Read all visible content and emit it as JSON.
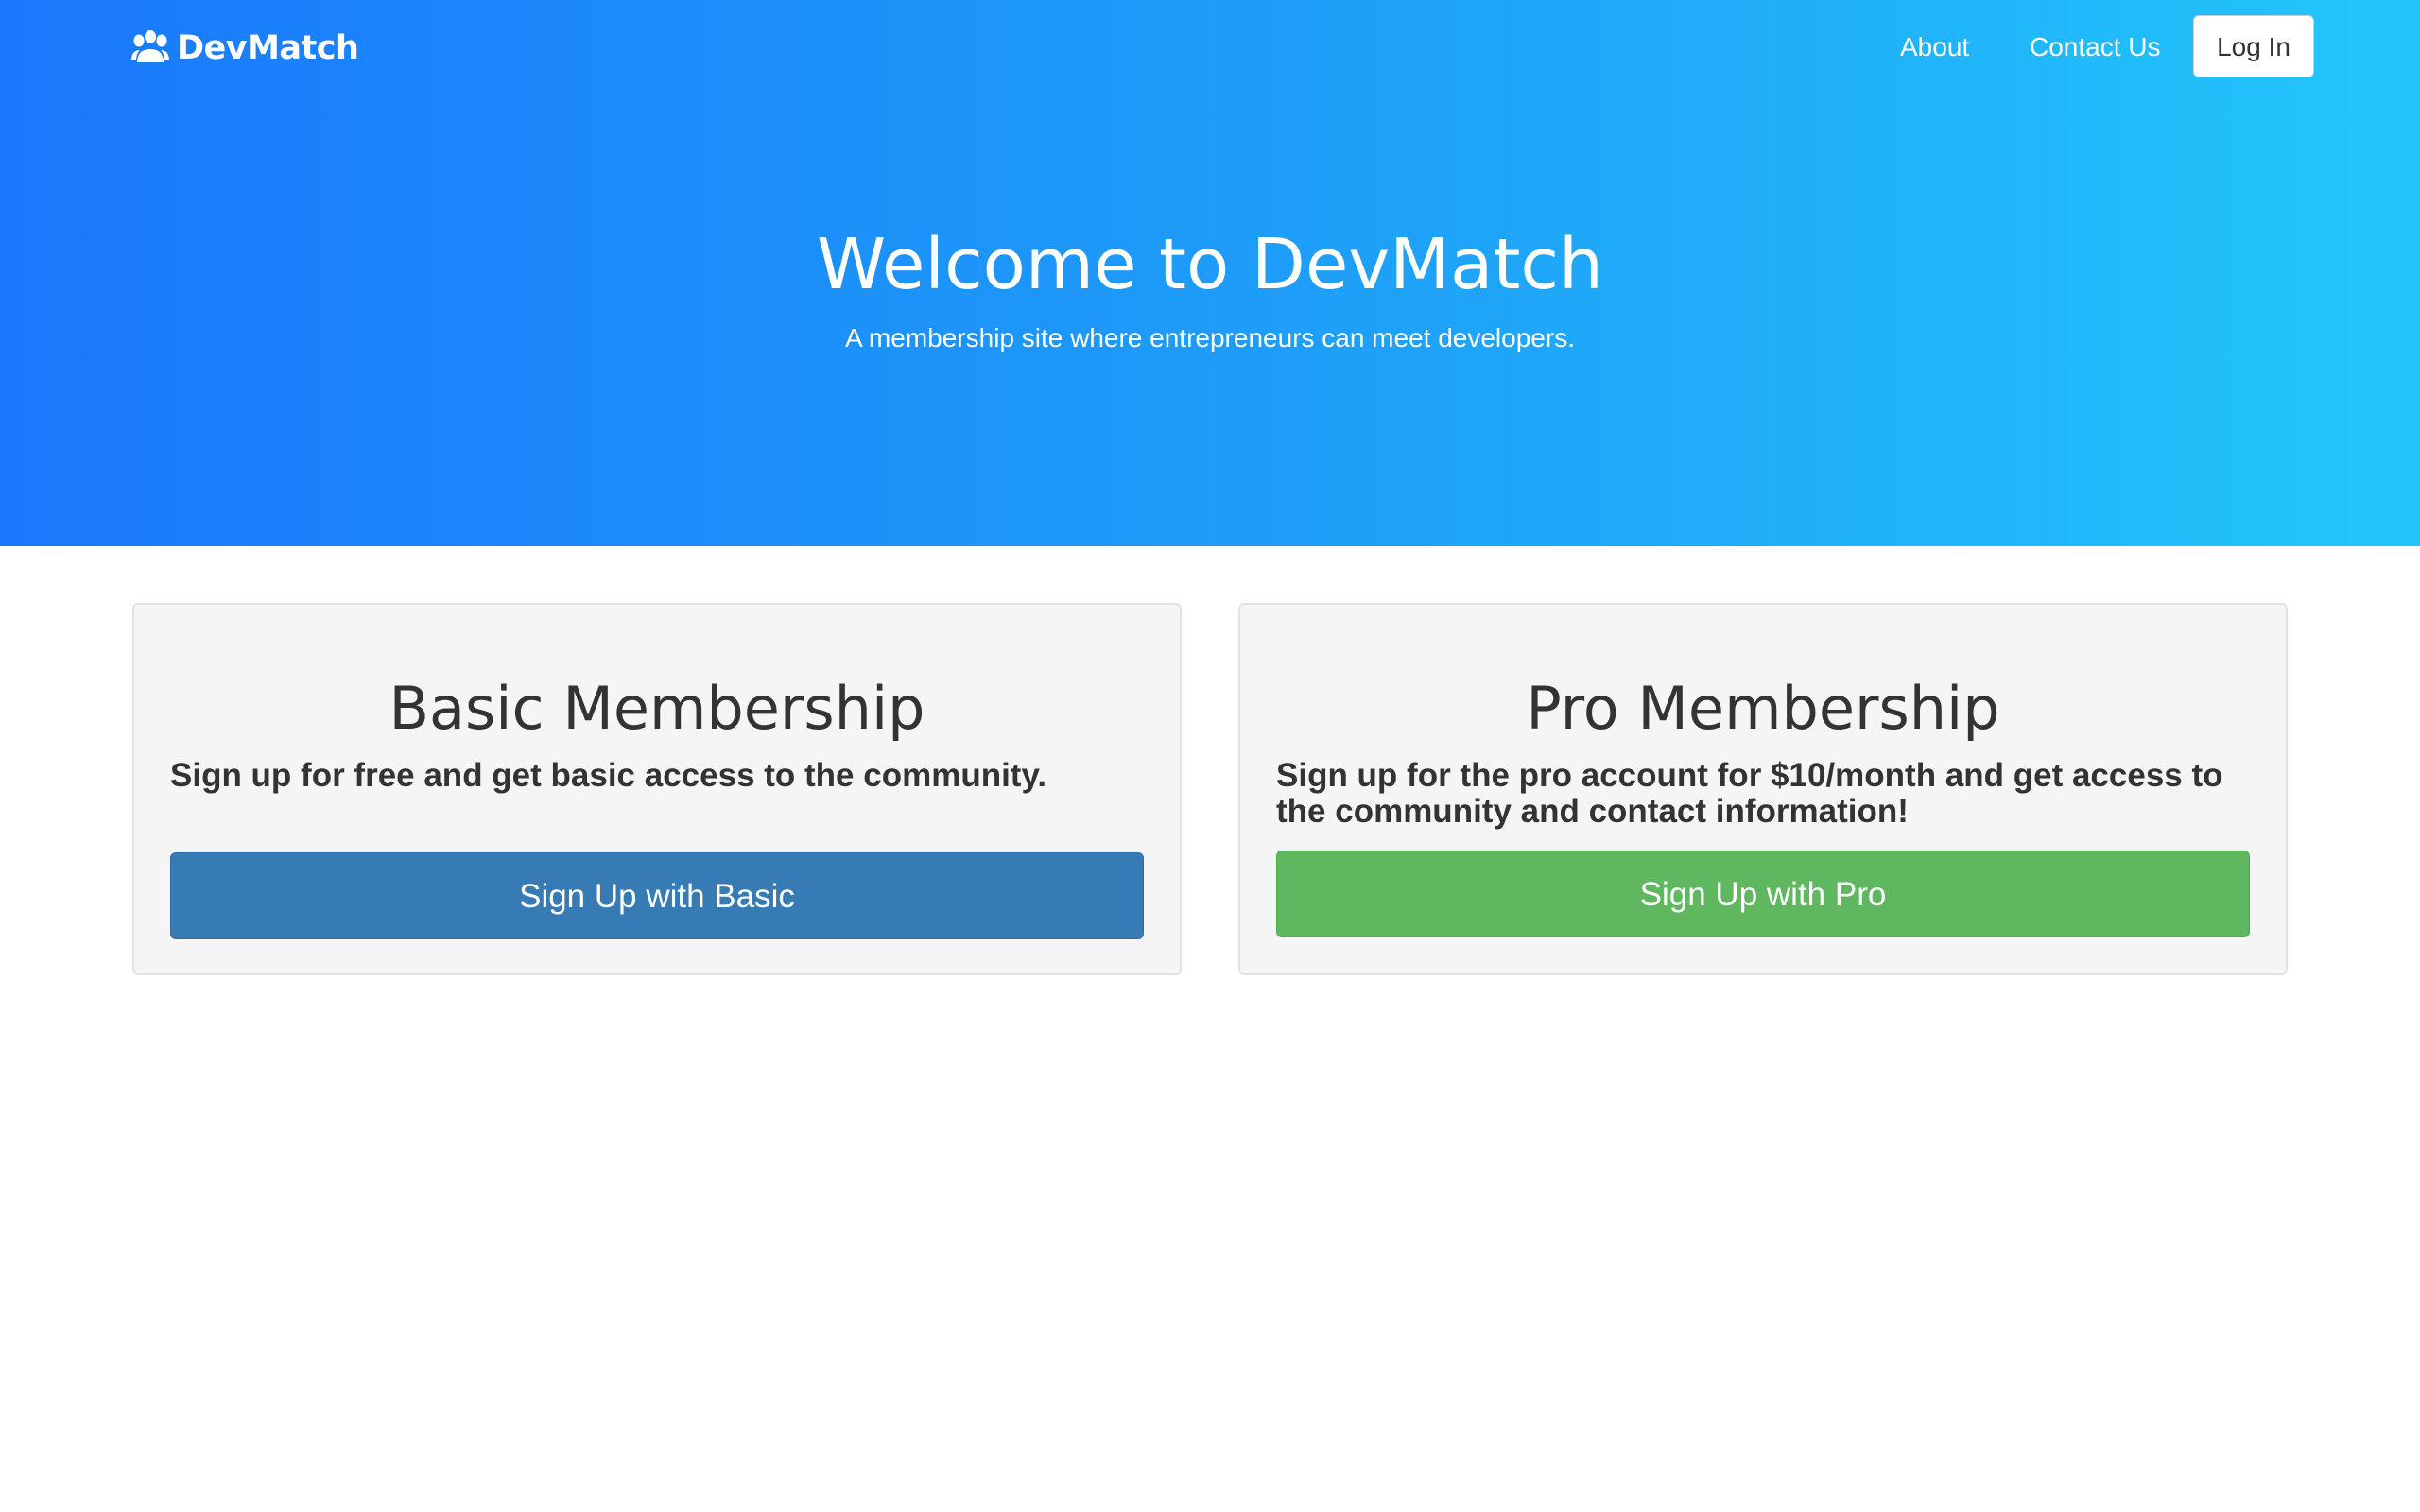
{
  "navbar": {
    "brand_name": "DevMatch",
    "brand_icon": "paw-icon",
    "links": {
      "about": "About",
      "contact": "Contact Us"
    },
    "login_label": "Log In"
  },
  "hero": {
    "title": "Welcome to DevMatch",
    "subtitle": "A membership site where entrepreneurs can meet developers."
  },
  "plans": {
    "basic": {
      "title": "Basic Membership",
      "description": "Sign up for free and get basic access to the community.",
      "button_label": "Sign Up with Basic"
    },
    "pro": {
      "title": "Pro Membership",
      "description": "Sign up for the pro account for $10/month and get access to the community and contact information!",
      "button_label": "Sign Up with Pro"
    }
  },
  "colors": {
    "hero_gradient_start": "#1a78fc",
    "hero_gradient_end": "#22c6fb",
    "basic_button": "#377bb5",
    "pro_button": "#5fb760",
    "card_background": "#f5f5f5"
  }
}
